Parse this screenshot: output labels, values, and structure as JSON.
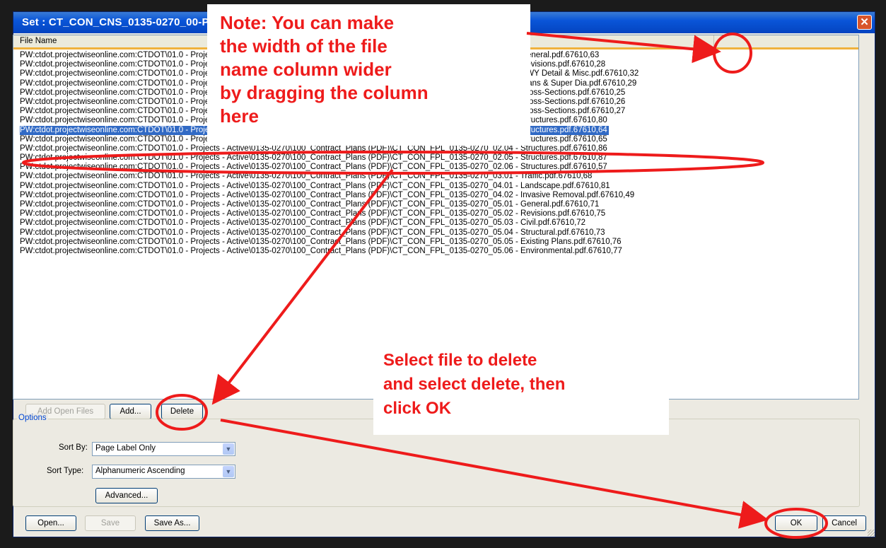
{
  "window": {
    "title": "Set : CT_CON_CNS_0135-0270_00-Pl"
  },
  "listview": {
    "column_header": "File Name",
    "rows": [
      "PW:ctdot.projectwiseonline.com:CTDOT\\01.0 - Projects - Active\\0135-0270\\100_Contract_Plans (PDF)\\CT_CON_FPL_0135-0270_01.01 - General.pdf.67610,63",
      "PW:ctdot.projectwiseonline.com:CTDOT\\01.0 - Projects - Active\\0135-0270\\100_Contract_Plans (PDF)\\CT_CON_FPL_0135-0270_01.02 - Revisions.pdf.67610,28",
      "PW:ctdot.projectwiseonline.com:CTDOT\\01.0 - Projects - Active\\0135-0270\\100_Contract_Plans (PDF)\\CT_CON_FPL_0135-0270_01.03 - HWY Detail & Misc.pdf.67610,32",
      "PW:ctdot.projectwiseonline.com:CTDOT\\01.0 - Projects - Active\\0135-0270\\100_Contract_Plans (PDF)\\CT_CON_FPL_0135-0270_01.04 - Plans & Super Dia.pdf.67610,29",
      "PW:ctdot.projectwiseonline.com:CTDOT\\01.0 - Projects - Active\\0135-0270\\100_Contract_Plans (PDF)\\CT_CON_FPL_0135-0270_01.05 - Cross-Sections.pdf.67610,25",
      "PW:ctdot.projectwiseonline.com:CTDOT\\01.0 - Projects - Active\\0135-0270\\100_Contract_Plans (PDF)\\CT_CON_FPL_0135-0270_01.06 - Cross-Sections.pdf.67610,26",
      "PW:ctdot.projectwiseonline.com:CTDOT\\01.0 - Projects - Active\\0135-0270\\100_Contract_Plans (PDF)\\CT_CON_FPL_0135-0270_01.07 - Cross-Sections.pdf.67610,27",
      "PW:ctdot.projectwiseonline.com:CTDOT\\01.0 - Projects - Active\\0135-0270\\100_Contract_Plans (PDF)\\CT_CON_FPL_0135-0270_02.01 - Structures.pdf.67610,80",
      "PW:ctdot.projectwiseonline.com:CTDOT\\01.0 - Projects - Active\\0135-0270\\100_Contract_Plans (PDF)\\CT_CON_FPL_0135-0270_02.02 - Structures.pdf.67610,64",
      "PW:ctdot.projectwiseonline.com:CTDOT\\01.0 - Projects - Active\\0135-0270\\100_Contract_Plans (PDF)\\CT_CON_FPL_0135-0270_02.03 - Structures.pdf.67610,65",
      "PW:ctdot.projectwiseonline.com:CTDOT\\01.0 - Projects - Active\\0135-0270\\100_Contract_Plans (PDF)\\CT_CON_FPL_0135-0270_02.04 - Structures.pdf.67610,86",
      "PW:ctdot.projectwiseonline.com:CTDOT\\01.0 - Projects - Active\\0135-0270\\100_Contract_Plans (PDF)\\CT_CON_FPL_0135-0270_02.05 - Structures.pdf.67610,87",
      "PW:ctdot.projectwiseonline.com:CTDOT\\01.0 - Projects - Active\\0135-0270\\100_Contract_Plans (PDF)\\CT_CON_FPL_0135-0270_02.06 - Structures.pdf.67610,57",
      "PW:ctdot.projectwiseonline.com:CTDOT\\01.0 - Projects - Active\\0135-0270\\100_Contract_Plans (PDF)\\CT_CON_FPL_0135-0270_03.01 - Traffic.pdf.67610,68",
      "PW:ctdot.projectwiseonline.com:CTDOT\\01.0 - Projects - Active\\0135-0270\\100_Contract_Plans (PDF)\\CT_CON_FPL_0135-0270_04.01 - Landscape.pdf.67610,81",
      "PW:ctdot.projectwiseonline.com:CTDOT\\01.0 - Projects - Active\\0135-0270\\100_Contract_Plans (PDF)\\CT_CON_FPL_0135-0270_04.02 - Invasive Removal.pdf.67610,49",
      "PW:ctdot.projectwiseonline.com:CTDOT\\01.0 - Projects - Active\\0135-0270\\100_Contract_Plans (PDF)\\CT_CON_FPL_0135-0270_05.01 - General.pdf.67610,71",
      "PW:ctdot.projectwiseonline.com:CTDOT\\01.0 - Projects - Active\\0135-0270\\100_Contract_Plans (PDF)\\CT_CON_FPL_0135-0270_05.02 - Revisions.pdf.67610,75",
      "PW:ctdot.projectwiseonline.com:CTDOT\\01.0 - Projects - Active\\0135-0270\\100_Contract_Plans (PDF)\\CT_CON_FPL_0135-0270_05.03 - Civil.pdf.67610,72",
      "PW:ctdot.projectwiseonline.com:CTDOT\\01.0 - Projects - Active\\0135-0270\\100_Contract_Plans (PDF)\\CT_CON_FPL_0135-0270_05.04 - Structural.pdf.67610,73",
      "PW:ctdot.projectwiseonline.com:CTDOT\\01.0 - Projects - Active\\0135-0270\\100_Contract_Plans (PDF)\\CT_CON_FPL_0135-0270_05.05 - Existing Plans.pdf.67610,76",
      "PW:ctdot.projectwiseonline.com:CTDOT\\01.0 - Projects - Active\\0135-0270\\100_Contract_Plans (PDF)\\CT_CON_FPL_0135-0270_05.06 - Environmental.pdf.67610,77"
    ],
    "selected_index": 8
  },
  "buttons": {
    "add_open_files": "Add Open Files",
    "add": "Add...",
    "delete": "Delete",
    "advanced": "Advanced...",
    "open": "Open...",
    "save": "Save",
    "save_as": "Save As...",
    "ok": "OK",
    "cancel": "Cancel"
  },
  "options": {
    "group_label": "Options",
    "sort_by_label": "Sort By:",
    "sort_by_value": "Page Label Only",
    "sort_type_label": "Sort Type:",
    "sort_type_value": "Alphanumeric Ascending"
  },
  "annotations": {
    "note_lines": [
      "Note:  You can make",
      "the width of the file",
      "name column wider",
      "by dragging the column",
      "here"
    ],
    "select_lines": [
      "Select file to delete",
      "and select delete, then",
      "click OK"
    ],
    "color": "#ee1b1b"
  }
}
